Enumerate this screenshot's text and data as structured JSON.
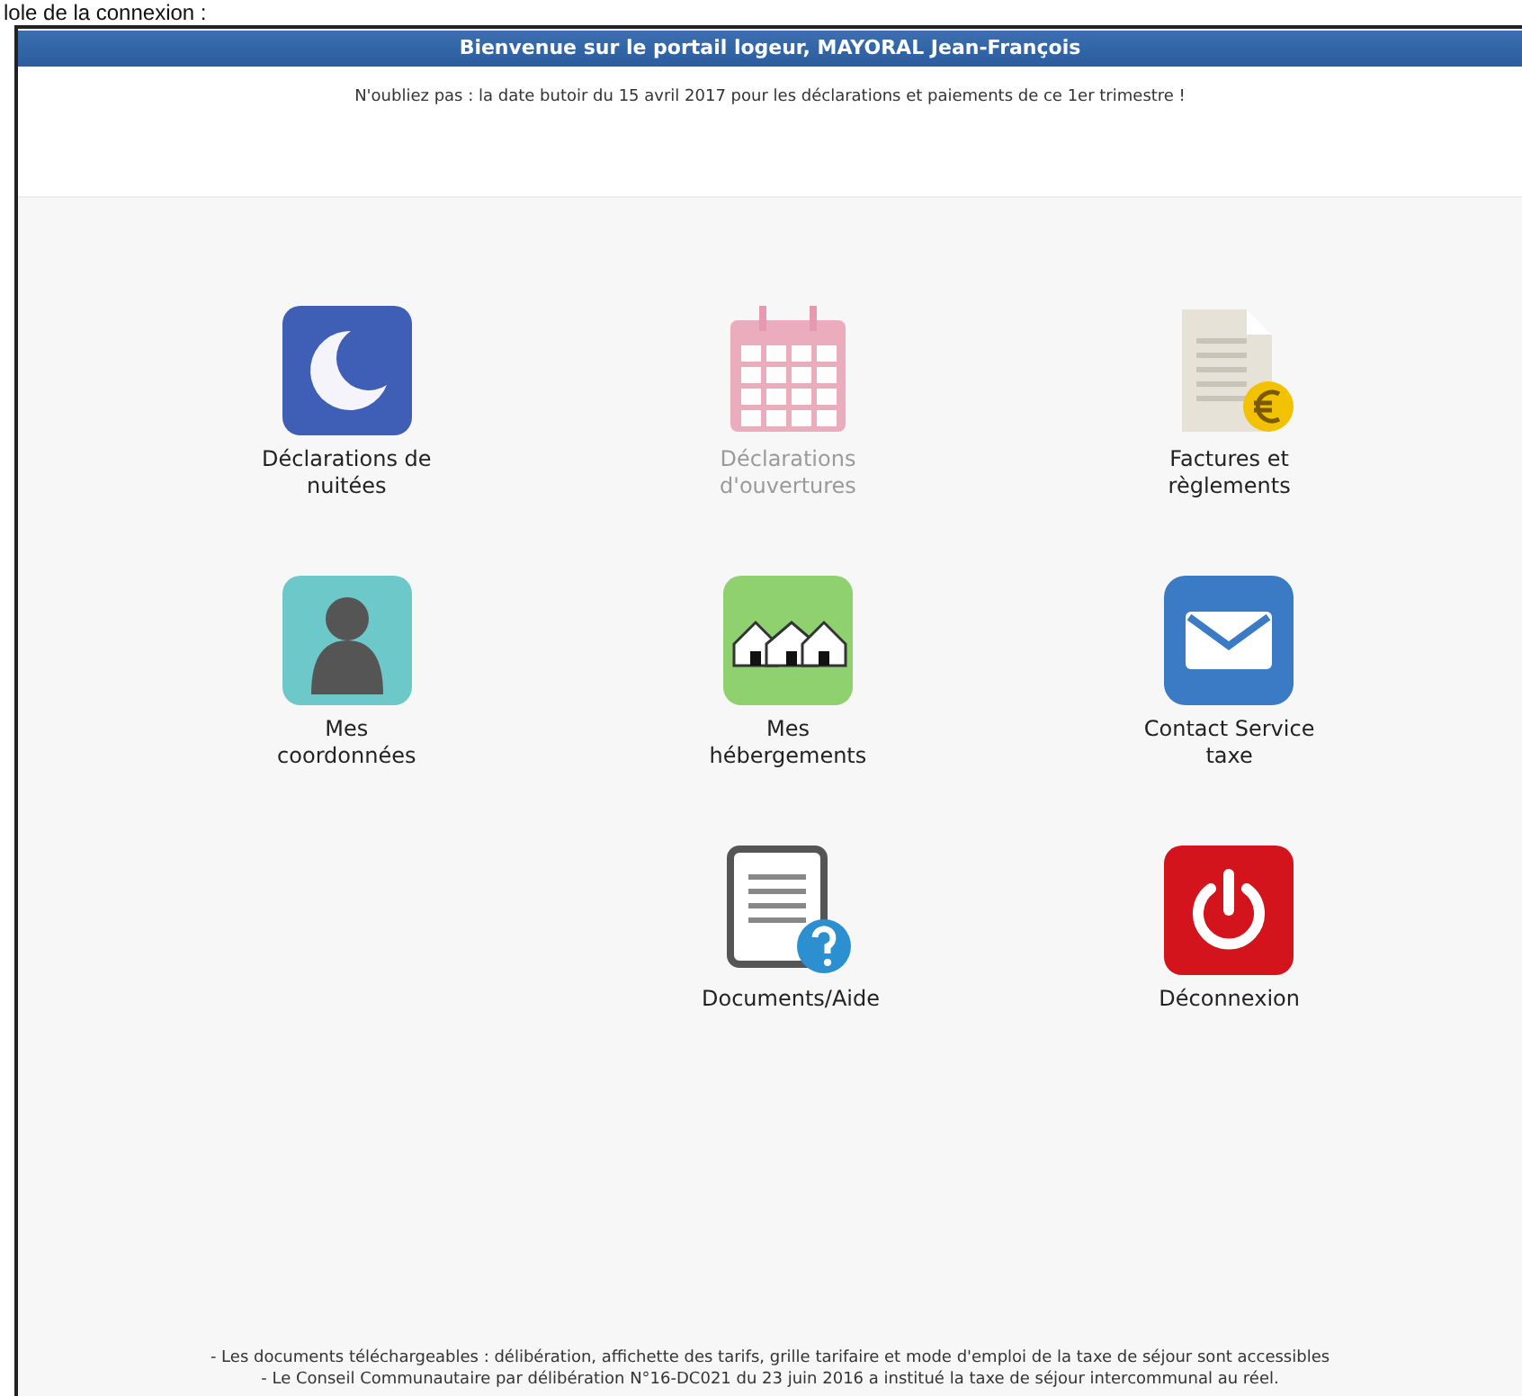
{
  "caption": "lole de la connexion :",
  "header": {
    "title": "Bienvenue sur le portail logeur, MAYORAL Jean-François"
  },
  "notice": "N'oubliez pas : la date butoir du 15 avril 2017 pour les déclarations et paiements de ce 1er trimestre !",
  "rows": [
    [
      {
        "kind": "moon",
        "label": "Déclarations de nuitées",
        "disabled": false
      },
      {
        "kind": "calendar",
        "label": "Déclarations d'ouvertures",
        "disabled": true
      },
      {
        "kind": "invoice",
        "label": "Factures et règlements",
        "disabled": false
      }
    ],
    [
      {
        "kind": "person",
        "label": "Mes coordonnées",
        "disabled": false
      },
      {
        "kind": "houses",
        "label": "Mes hébergements",
        "disabled": false
      },
      {
        "kind": "mail",
        "label": "Contact Service taxe",
        "disabled": false
      }
    ],
    [
      {
        "kind": "help",
        "label": "Documents/Aide",
        "disabled": false
      },
      {
        "kind": "power",
        "label": "Déconnexion",
        "disabled": false
      }
    ]
  ],
  "footer": [
    "- Les documents téléchargeables : délibération, affichette des tarifs, grille tarifaire et mode d'emploi de la taxe de séjour sont accessibles",
    "- Le Conseil Communautaire par délibération N°16-DC021 du 23 juin 2016 a institué la taxe de séjour intercommunal au réel."
  ]
}
